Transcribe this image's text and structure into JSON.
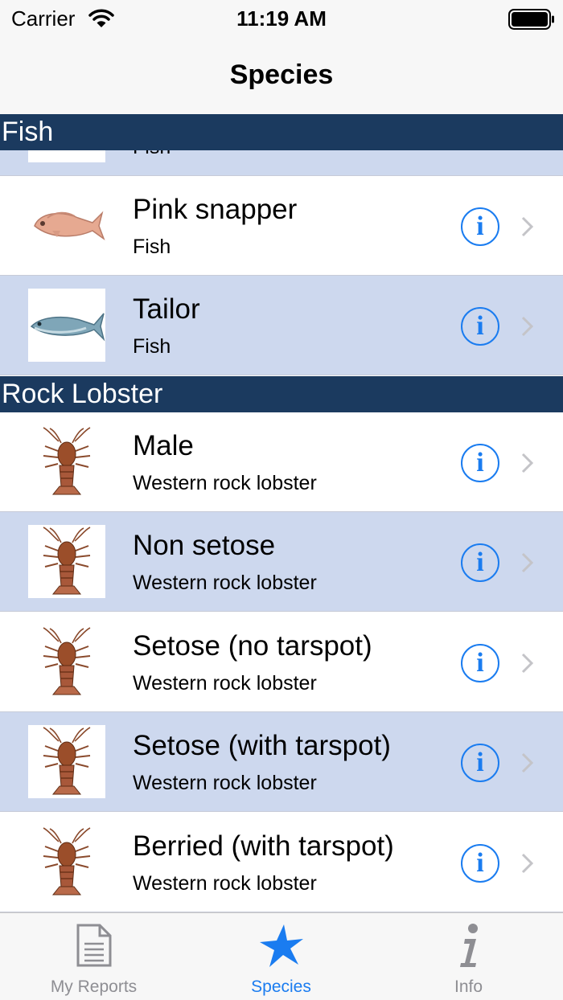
{
  "status_bar": {
    "carrier": "Carrier",
    "time": "11:19 AM"
  },
  "nav": {
    "title": "Species"
  },
  "sections": [
    {
      "title": "Fish",
      "rows": [
        {
          "title": "",
          "subtitle": "Fish",
          "thumb": "fish-icon"
        },
        {
          "title": "Pink snapper",
          "subtitle": "Fish",
          "thumb": "pink-snapper-icon"
        },
        {
          "title": "Tailor",
          "subtitle": "Fish",
          "thumb": "tailor-fish-icon"
        }
      ]
    },
    {
      "title": "Rock Lobster",
      "rows": [
        {
          "title": "Male",
          "subtitle": "Western rock lobster",
          "thumb": "lobster-icon"
        },
        {
          "title": "Non setose",
          "subtitle": "Western rock lobster",
          "thumb": "lobster-icon"
        },
        {
          "title": "Setose (no tarspot)",
          "subtitle": "Western rock lobster",
          "thumb": "lobster-icon"
        },
        {
          "title": "Setose (with tarspot)",
          "subtitle": "Western rock lobster",
          "thumb": "lobster-icon"
        },
        {
          "title": "Berried (with tarspot)",
          "subtitle": "Western rock lobster",
          "thumb": "lobster-icon"
        }
      ]
    }
  ],
  "tab_bar": {
    "tabs": [
      {
        "label": "My Reports",
        "icon": "document-icon"
      },
      {
        "label": "Species",
        "icon": "star-icon"
      },
      {
        "label": "Info",
        "icon": "info-icon"
      }
    ],
    "active_index": 1
  },
  "colors": {
    "section_header": "#1b3a5f",
    "row_alt": "#cdd8ee",
    "accent": "#1a7cf0"
  }
}
